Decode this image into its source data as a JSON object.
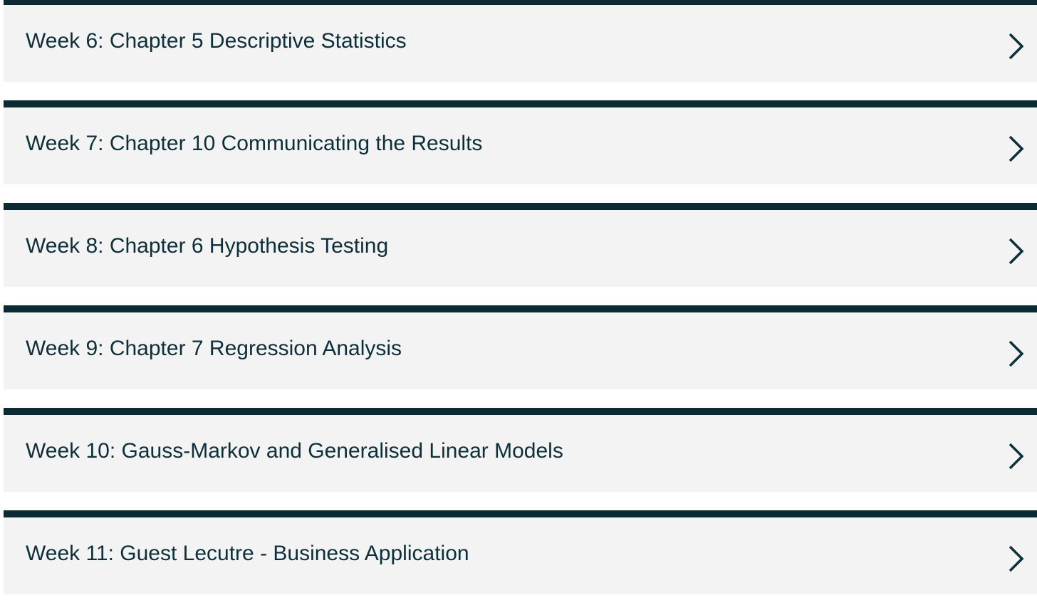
{
  "modules": {
    "items": [
      {
        "label": "Week 6: Chapter 5 Descriptive Statistics",
        "icon": "chevron-right-icon"
      },
      {
        "label": "Week 7: Chapter 10 Communicating the Results",
        "icon": "chevron-right-icon"
      },
      {
        "label": "Week 8: Chapter 6 Hypothesis Testing",
        "icon": "chevron-right-icon"
      },
      {
        "label": "Week 9: Chapter 7 Regression Analysis",
        "icon": "chevron-right-icon"
      },
      {
        "label": "Week 10: Gauss-Markov and Generalised Linear Models",
        "icon": "chevron-right-icon"
      },
      {
        "label": "Week 11: Guest Lecutre - Business Application",
        "icon": "chevron-right-icon"
      }
    ]
  },
  "colors": {
    "header_bar": "#0a2b33",
    "item_background": "#f3f3f3",
    "text": "#0d2f3a"
  }
}
